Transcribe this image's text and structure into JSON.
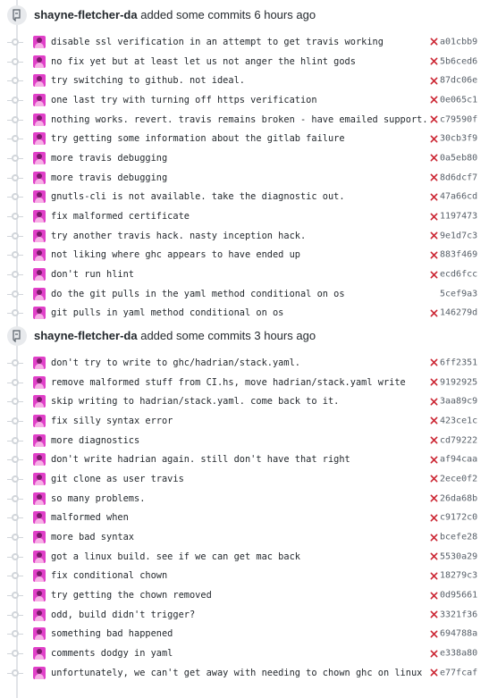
{
  "groups": [
    {
      "author": "shayne-fletcher-da",
      "action": "added some commits 6 hours ago",
      "commits": [
        {
          "message": "disable ssl verification in an attempt to get travis working",
          "sha": "a01cbb9",
          "failed": true
        },
        {
          "message": "no fix yet but at least let us not anger the hlint gods",
          "sha": "5b6ced6",
          "failed": true
        },
        {
          "message": "try switching to github. not ideal.",
          "sha": "87dc06e",
          "failed": true
        },
        {
          "message": "one last try with turning off https verification",
          "sha": "0e065c1",
          "failed": true
        },
        {
          "message": "nothing works. revert. travis remains broken - have emailed support.",
          "sha": "c79590f",
          "failed": true
        },
        {
          "message": "try getting some information about the gitlab failure",
          "sha": "30cb3f9",
          "failed": true
        },
        {
          "message": "more travis debugging",
          "sha": "0a5eb80",
          "failed": true
        },
        {
          "message": "more travis debugging",
          "sha": "8d6dcf7",
          "failed": true
        },
        {
          "message": "gnutls-cli is not available. take the diagnostic out.",
          "sha": "47a66cd",
          "failed": true
        },
        {
          "message": "fix malformed certificate",
          "sha": "1197473",
          "failed": true
        },
        {
          "message": "try another travis hack. nasty inception hack.",
          "sha": "9e1d7c3",
          "failed": true
        },
        {
          "message": "not liking where ghc appears to have ended up",
          "sha": "883f469",
          "failed": true
        },
        {
          "message": "don't run hlint",
          "sha": "ecd6fcc",
          "failed": true
        },
        {
          "message": "do the git pulls in the yaml method conditional on os",
          "sha": "5cef9a3",
          "failed": false
        },
        {
          "message": "git pulls in yaml method conditional on os",
          "sha": "146279d",
          "failed": true
        }
      ]
    },
    {
      "author": "shayne-fletcher-da",
      "action": "added some commits 3 hours ago",
      "commits": [
        {
          "message": "don't try to write to ghc/hadrian/stack.yaml.",
          "sha": "6ff2351",
          "failed": true
        },
        {
          "message": "remove malformed stuff from CI.hs, move hadrian/stack.yaml write",
          "sha": "9192925",
          "failed": true
        },
        {
          "message": "skip writing to hadrian/stack.yaml. come back to it.",
          "sha": "3aa89c9",
          "failed": true
        },
        {
          "message": "fix silly syntax error",
          "sha": "423ce1c",
          "failed": true
        },
        {
          "message": "more diagnostics",
          "sha": "cd79222",
          "failed": true
        },
        {
          "message": "don't write hadrian again. still don't have that right",
          "sha": "af94caa",
          "failed": true
        },
        {
          "message": "git clone as user travis",
          "sha": "2ece0f2",
          "failed": true
        },
        {
          "message": "so many problems.",
          "sha": "26da68b",
          "failed": true
        },
        {
          "message": "malformed when",
          "sha": "c9172c0",
          "failed": true
        },
        {
          "message": "more bad syntax",
          "sha": "bcefe28",
          "failed": true
        },
        {
          "message": "got a linux build. see if we can get mac back",
          "sha": "5530a29",
          "failed": true
        },
        {
          "message": "fix conditional chown",
          "sha": "18279c3",
          "failed": true
        },
        {
          "message": "try getting the chown removed",
          "sha": "0d95661",
          "failed": true
        },
        {
          "message": "odd, build didn't trigger?",
          "sha": "3321f36",
          "failed": true
        },
        {
          "message": "something bad happened",
          "sha": "694788a",
          "failed": true
        },
        {
          "message": "comments dodgy in yaml",
          "sha": "e338a80",
          "failed": true
        },
        {
          "message": "unfortunately, we can't get away with needing to chown ghc on linux",
          "sha": "e77fcaf",
          "failed": true
        }
      ]
    }
  ],
  "colors": {
    "fail": "#cb2431",
    "text": "#24292e",
    "muted": "#586069",
    "line": "#e1e4e8"
  }
}
